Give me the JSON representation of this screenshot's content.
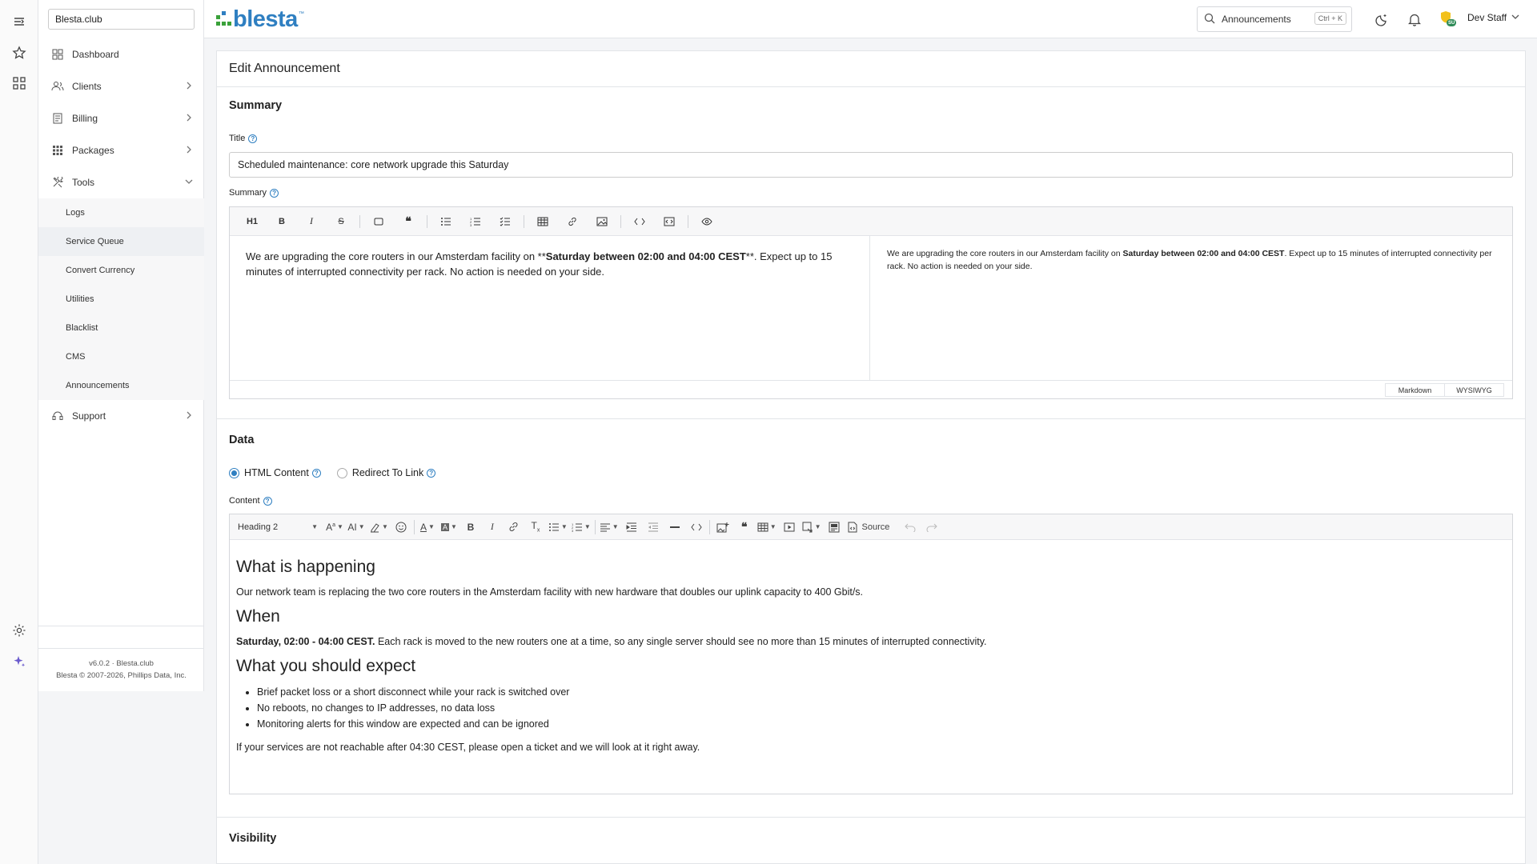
{
  "sidebar": {
    "site_value": "Blesta.club",
    "items": [
      {
        "label": "Dashboard"
      },
      {
        "label": "Clients"
      },
      {
        "label": "Billing"
      },
      {
        "label": "Packages"
      },
      {
        "label": "Tools"
      },
      {
        "label": "Support"
      }
    ],
    "tools_sub": [
      "Logs",
      "Service Queue",
      "Convert Currency",
      "Utilities",
      "Blacklist",
      "CMS",
      "Announcements"
    ],
    "footer_version": "v6.0.2 · Blesta.club",
    "footer_copy": "Blesta © 2007-2026, Phillips Data, Inc."
  },
  "topbar": {
    "logo": "blesta",
    "search_value": "Announcements",
    "search_shortcut": "Ctrl + K",
    "badge": "SU",
    "user": "Dev Staff"
  },
  "page": {
    "title": "Edit Announcement",
    "summary_section": "Summary",
    "title_label": "Title",
    "title_value": "Scheduled maintenance: core network upgrade this Saturday",
    "summary_label": "Summary",
    "md_toolbar_h1": "H1",
    "md_source_pre": "We are upgrading the core routers in our Amsterdam facility on **",
    "md_source_bold": "Saturday between 02:00 and 04:00 CEST",
    "md_source_post": "**. Expect up to 15 minutes of interrupted connectivity per rack. No action is needed on your side.",
    "md_preview_pre": "We are upgrading the core routers in our Amsterdam facility on ",
    "md_preview_bold": "Saturday between 02:00 and 04:00 CEST",
    "md_preview_post": ". Expect up to 15 minutes of interrupted connectivity per rack. No action is needed on your side.",
    "mode_markdown": "Markdown",
    "mode_wysiwyg": "WYSIWYG",
    "data_section": "Data",
    "radio_html": "HTML Content",
    "radio_redirect": "Redirect To Link",
    "content_label": "Content",
    "heading_select": "Heading 2",
    "source_label": "Source",
    "visibility_section": "Visibility"
  },
  "content": {
    "h_happening": "What is happening",
    "p_happening": "Our network team is replacing the two core routers in the Amsterdam facility with new hardware that doubles our uplink capacity to 400 Gbit/s.",
    "h_when": "When",
    "p_when_bold": "Saturday, 02:00 - 04:00 CEST.",
    "p_when_rest": " Each rack is moved to the new routers one at a time, so any single server should see no more than 15 minutes of interrupted connectivity.",
    "h_expect": "What you should expect",
    "list": [
      "Brief packet loss or a short disconnect while your rack is switched over",
      "No reboots, no changes to IP addresses, no data loss",
      "Monitoring alerts for this window are expected and can be ignored"
    ],
    "p_final": "If your services are not reachable after 04:30 CEST, please open a ticket and we will look at it right away."
  },
  "colors": {
    "accent": "#2f7fc1",
    "logo_green": "#3aa13a",
    "badge_yellow": "#f2c11c",
    "badge_green": "#2e8b57"
  }
}
